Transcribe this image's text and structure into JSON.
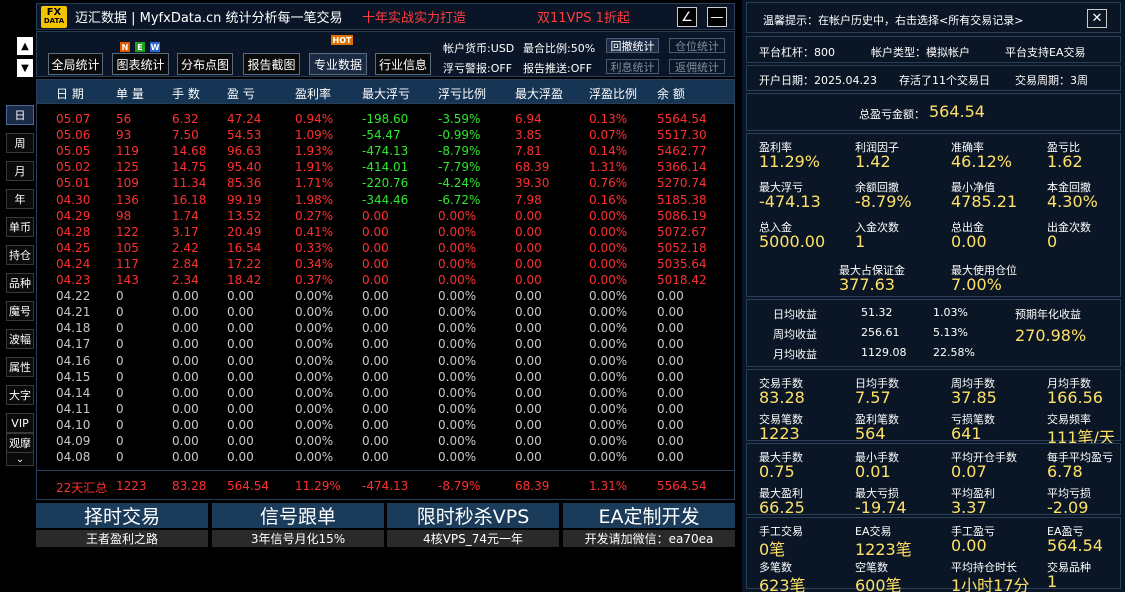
{
  "title": {
    "logo_top": "FX",
    "logo_bottom": "DATA",
    "app": "迈汇数据 | MyfxData.cn  统计分析每一笔交易",
    "slogan1": "十年实战实力打造",
    "slogan2": "双11VPS 1折起",
    "minimize": "∠",
    "maximize": "—"
  },
  "sidebar": {
    "up": "▲",
    "down": "▼",
    "items": [
      "日",
      "周",
      "月",
      "年",
      "单币",
      "持仓",
      "品种",
      "魔号",
      "波幅",
      "属性",
      "大字",
      "VIP",
      "观摩"
    ],
    "more": "⌄"
  },
  "toolbar": {
    "buttons": [
      "全局统计",
      "图表统计",
      "分布点图",
      "报告截图",
      "专业数据",
      "行业信息"
    ],
    "tag_n": "N",
    "tag_e": "E",
    "tag_w": "W",
    "tag_hot": "HOT",
    "currency": "帐户货币:USD",
    "ratio": "最合比例:50%",
    "float_alert": "浮亏警报:OFF",
    "report_push": "报告推送:OFF",
    "small": [
      "回撤统计",
      "仓位统计",
      "利息统计",
      "返佣统计"
    ]
  },
  "table": {
    "headers": [
      "日 期",
      "单 量",
      "手 数",
      "盈 亏",
      "盈利率",
      "最大浮亏",
      "浮亏比例",
      "最大浮盈",
      "浮盈比例",
      "余 额"
    ],
    "rows": [
      [
        "05.07",
        "56",
        "6.32",
        "47.24",
        "0.94%",
        "-198.60",
        "-3.59%",
        "6.94",
        "0.13%",
        "5564.54"
      ],
      [
        "05.06",
        "93",
        "7.50",
        "54.53",
        "1.09%",
        "-54.47",
        "-0.99%",
        "3.85",
        "0.07%",
        "5517.30"
      ],
      [
        "05.05",
        "119",
        "14.68",
        "96.63",
        "1.93%",
        "-474.13",
        "-8.79%",
        "7.81",
        "0.14%",
        "5462.77"
      ],
      [
        "05.02",
        "125",
        "14.75",
        "95.40",
        "1.91%",
        "-414.01",
        "-7.79%",
        "68.39",
        "1.31%",
        "5366.14"
      ],
      [
        "05.01",
        "109",
        "11.34",
        "85.36",
        "1.71%",
        "-220.76",
        "-4.24%",
        "39.30",
        "0.76%",
        "5270.74"
      ],
      [
        "04.30",
        "136",
        "16.18",
        "99.19",
        "1.98%",
        "-344.46",
        "-6.72%",
        "7.98",
        "0.16%",
        "5185.38"
      ],
      [
        "04.29",
        "98",
        "1.74",
        "13.52",
        "0.27%",
        "0.00",
        "0.00%",
        "0.00",
        "0.00%",
        "5086.19"
      ],
      [
        "04.28",
        "122",
        "3.17",
        "20.49",
        "0.41%",
        "0.00",
        "0.00%",
        "0.00",
        "0.00%",
        "5072.67"
      ],
      [
        "04.25",
        "105",
        "2.42",
        "16.54",
        "0.33%",
        "0.00",
        "0.00%",
        "0.00",
        "0.00%",
        "5052.18"
      ],
      [
        "04.24",
        "117",
        "2.84",
        "17.22",
        "0.34%",
        "0.00",
        "0.00%",
        "0.00",
        "0.00%",
        "5035.64"
      ],
      [
        "04.23",
        "143",
        "2.34",
        "18.42",
        "0.37%",
        "0.00",
        "0.00%",
        "0.00",
        "0.00%",
        "5018.42"
      ],
      [
        "04.22",
        "0",
        "0.00",
        "0.00",
        "0.00%",
        "0.00",
        "0.00%",
        "0.00",
        "0.00%",
        "0.00"
      ],
      [
        "04.21",
        "0",
        "0.00",
        "0.00",
        "0.00%",
        "0.00",
        "0.00%",
        "0.00",
        "0.00%",
        "0.00"
      ],
      [
        "04.18",
        "0",
        "0.00",
        "0.00",
        "0.00%",
        "0.00",
        "0.00%",
        "0.00",
        "0.00%",
        "0.00"
      ],
      [
        "04.17",
        "0",
        "0.00",
        "0.00",
        "0.00%",
        "0.00",
        "0.00%",
        "0.00",
        "0.00%",
        "0.00"
      ],
      [
        "04.16",
        "0",
        "0.00",
        "0.00",
        "0.00%",
        "0.00",
        "0.00%",
        "0.00",
        "0.00%",
        "0.00"
      ],
      [
        "04.15",
        "0",
        "0.00",
        "0.00",
        "0.00%",
        "0.00",
        "0.00%",
        "0.00",
        "0.00%",
        "0.00"
      ],
      [
        "04.14",
        "0",
        "0.00",
        "0.00",
        "0.00%",
        "0.00",
        "0.00%",
        "0.00",
        "0.00%",
        "0.00"
      ],
      [
        "04.11",
        "0",
        "0.00",
        "0.00",
        "0.00%",
        "0.00",
        "0.00%",
        "0.00",
        "0.00%",
        "0.00"
      ],
      [
        "04.10",
        "0",
        "0.00",
        "0.00",
        "0.00%",
        "0.00",
        "0.00%",
        "0.00",
        "0.00%",
        "0.00"
      ],
      [
        "04.09",
        "0",
        "0.00",
        "0.00",
        "0.00%",
        "0.00",
        "0.00%",
        "0.00",
        "0.00%",
        "0.00"
      ],
      [
        "04.08",
        "0",
        "0.00",
        "0.00",
        "0.00%",
        "0.00",
        "0.00%",
        "0.00",
        "0.00%",
        "0.00"
      ]
    ],
    "summary": [
      "22天汇总",
      "1223",
      "83.28",
      "564.54",
      "11.29%",
      "-474.13",
      "-8.79%",
      "68.39",
      "1.31%",
      "5564.54"
    ]
  },
  "ads": [
    {
      "big": "择时交易",
      "small": "王者盈利之路"
    },
    {
      "big": "信号跟单",
      "small": "3年信号月化15%"
    },
    {
      "big": "限时秒杀VPS",
      "small": "4核VPS_74元一年"
    },
    {
      "big": "EA定制开发",
      "small": "开发请加微信：ea70ea"
    }
  ],
  "right": {
    "hint": "温馨提示：在帐户历史中，右击选择<所有交易记录>",
    "close": "✕",
    "leverage": "平台杠杆：800",
    "account_type": "帐户类型：模拟帐户",
    "ea_support": "平台支持EA交易",
    "open_date": "开户日期：2025.04.23",
    "existed": "存活了11个交易日",
    "cycle": "交易周期：3周",
    "total_label": "总盈亏金额：",
    "total_value": "564.54",
    "stats_a": [
      [
        "盈利率",
        "11.29%"
      ],
      [
        "利润因子",
        "1.42"
      ],
      [
        "准确率",
        "46.12%"
      ],
      [
        "盈亏比",
        "1.62"
      ],
      [
        "最大浮亏",
        "-474.13"
      ],
      [
        "余额回撤",
        "-8.79%"
      ],
      [
        "最小净值",
        "4785.21"
      ],
      [
        "本金回撤",
        "4.30%"
      ],
      [
        "总入金",
        "5000.00"
      ],
      [
        "入金次数",
        "1"
      ],
      [
        "总出金",
        "0.00"
      ],
      [
        "出金次数",
        "0"
      ]
    ],
    "margin": [
      [
        "最大占保证金",
        "377.63"
      ],
      [
        "最大使用仓位",
        "7.00%"
      ]
    ],
    "avg": [
      [
        "日均收益",
        "51.32",
        "1.03%"
      ],
      [
        "周均收益",
        "256.61",
        "5.13%"
      ],
      [
        "月均收益",
        "1129.08",
        "22.58%"
      ]
    ],
    "annual_label": "预期年化收益",
    "annual_value": "270.98%",
    "stats_b": [
      [
        "交易手数",
        "83.28"
      ],
      [
        "日均手数",
        "7.57"
      ],
      [
        "周均手数",
        "37.85"
      ],
      [
        "月均手数",
        "166.56"
      ],
      [
        "交易笔数",
        "1223"
      ],
      [
        "盈利笔数",
        "564"
      ],
      [
        "亏损笔数",
        "641"
      ],
      [
        "交易频率",
        "111笔/天"
      ]
    ],
    "stats_c": [
      [
        "最大手数",
        "0.75"
      ],
      [
        "最小手数",
        "0.01"
      ],
      [
        "平均开仓手数",
        "0.07"
      ],
      [
        "每手平均盈亏",
        "6.78"
      ],
      [
        "最大盈利",
        "66.25"
      ],
      [
        "最大亏损",
        "-19.74"
      ],
      [
        "平均盈利",
        "3.37"
      ],
      [
        "平均亏损",
        "-2.09"
      ]
    ],
    "stats_d": [
      [
        "手工交易",
        "0笔"
      ],
      [
        "EA交易",
        "1223笔"
      ],
      [
        "手工盈亏",
        "0.00"
      ],
      [
        "EA盈亏",
        "564.54"
      ],
      [
        "多笔数",
        "623笔"
      ],
      [
        "空笔数",
        "600笔"
      ],
      [
        "平均持仓时长",
        "1小时17分"
      ],
      [
        "交易品种",
        "1"
      ]
    ]
  }
}
